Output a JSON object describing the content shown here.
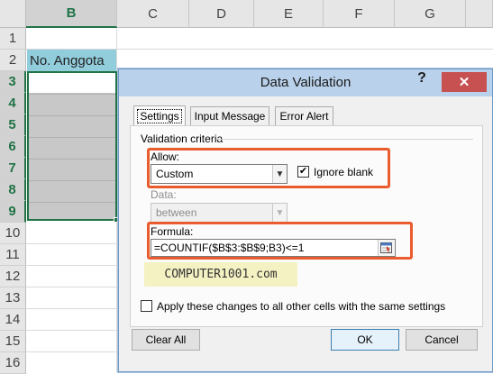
{
  "spreadsheet": {
    "columns": [
      "B",
      "C",
      "D",
      "E",
      "F",
      "G"
    ],
    "selected_column": "B",
    "rows": [
      "1",
      "2",
      "3",
      "4",
      "5",
      "6",
      "7",
      "8",
      "9",
      "10",
      "11",
      "12",
      "13",
      "14",
      "15",
      "16"
    ],
    "selected_rows": [
      "3",
      "4",
      "5",
      "6",
      "7",
      "8",
      "9"
    ],
    "header_cell_text": "No. Anggota",
    "header_cell_color": "#92cddc",
    "selection_color": "#c8c8c8",
    "accent_color": "#217346"
  },
  "dialog": {
    "title": "Data Validation",
    "help_label": "?",
    "close_label": "✕",
    "tabs": [
      {
        "label": "Settings",
        "active": true
      },
      {
        "label": "Input Message",
        "active": false
      },
      {
        "label": "Error Alert",
        "active": false
      }
    ],
    "group_label": "Validation criteria",
    "allow": {
      "label": "Allow:",
      "value": "Custom"
    },
    "ignore_blank": {
      "label": "Ignore blank",
      "checked": true
    },
    "data": {
      "label": "Data:",
      "value": "between",
      "disabled": true
    },
    "formula": {
      "label": "Formula:",
      "value": "=COUNTIF($B$3:$B$9;B3)<=1"
    },
    "watermark": "COMPUTER1001.com",
    "apply_all": {
      "label": "Apply these changes to all other cells with the same settings",
      "checked": false
    },
    "buttons": {
      "clear_all": "Clear All",
      "ok": "OK",
      "cancel": "Cancel"
    },
    "highlight_color": "#ea5b2e"
  }
}
